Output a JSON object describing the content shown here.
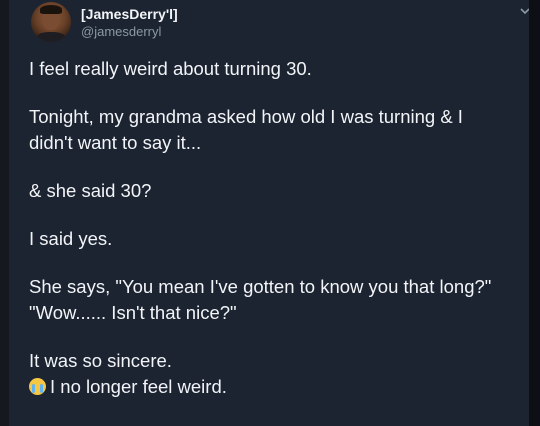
{
  "tweet": {
    "display_name": "[JamesDerry'l]",
    "handle": "@jamesderryl",
    "paragraphs": [
      "I feel really weird about turning 30.",
      "Tonight, my grandma asked how old I was turning & I didn't want to say it...",
      "& she said 30?",
      "I said yes.",
      "She says, \"You mean I've gotten to know you that long?\" \"Wow...... Isn't that nice?\""
    ],
    "last_line_1": "It was so sincere.",
    "last_line_2": "I no longer feel weird.",
    "emoji_icon": "loudly-crying-face-icon"
  },
  "colors": {
    "card_bg": "#1c2431",
    "text": "#f2f4f7",
    "secondary_text": "#8b98a5"
  }
}
